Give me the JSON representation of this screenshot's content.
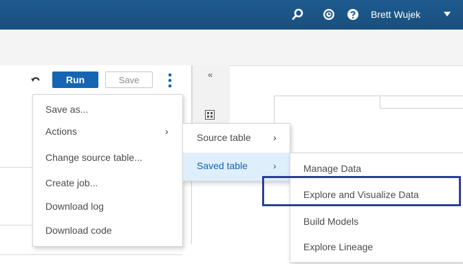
{
  "topbar": {
    "user_name": "Brett Wujek",
    "icons": [
      "search-icon",
      "recent-icon",
      "help-icon",
      "caret-down-icon"
    ]
  },
  "toolbar": {
    "run_label": "Run",
    "save_label": "Save",
    "collapse_label": "«"
  },
  "menu1": {
    "items": [
      {
        "label": "Save as..."
      },
      {
        "label": "Actions",
        "chevron": "›"
      },
      {
        "label": "Change source table..."
      },
      {
        "label": "Create job..."
      },
      {
        "label": "Download log"
      },
      {
        "label": "Download code"
      }
    ]
  },
  "menu2": {
    "items": [
      {
        "label": "Source table",
        "chevron": "›"
      },
      {
        "label": "Saved table",
        "chevron": "›"
      }
    ]
  },
  "menu3": {
    "items": [
      {
        "label": "Manage Data"
      },
      {
        "label": "Explore and Visualize Data"
      },
      {
        "label": "Build Models"
      },
      {
        "label": "Explore Lineage"
      }
    ]
  },
  "colors": {
    "topbar": "#1e5b8f",
    "run_button": "#1565b3",
    "highlight_border": "#2a3f96",
    "submenu_hover": "#deeefb"
  }
}
